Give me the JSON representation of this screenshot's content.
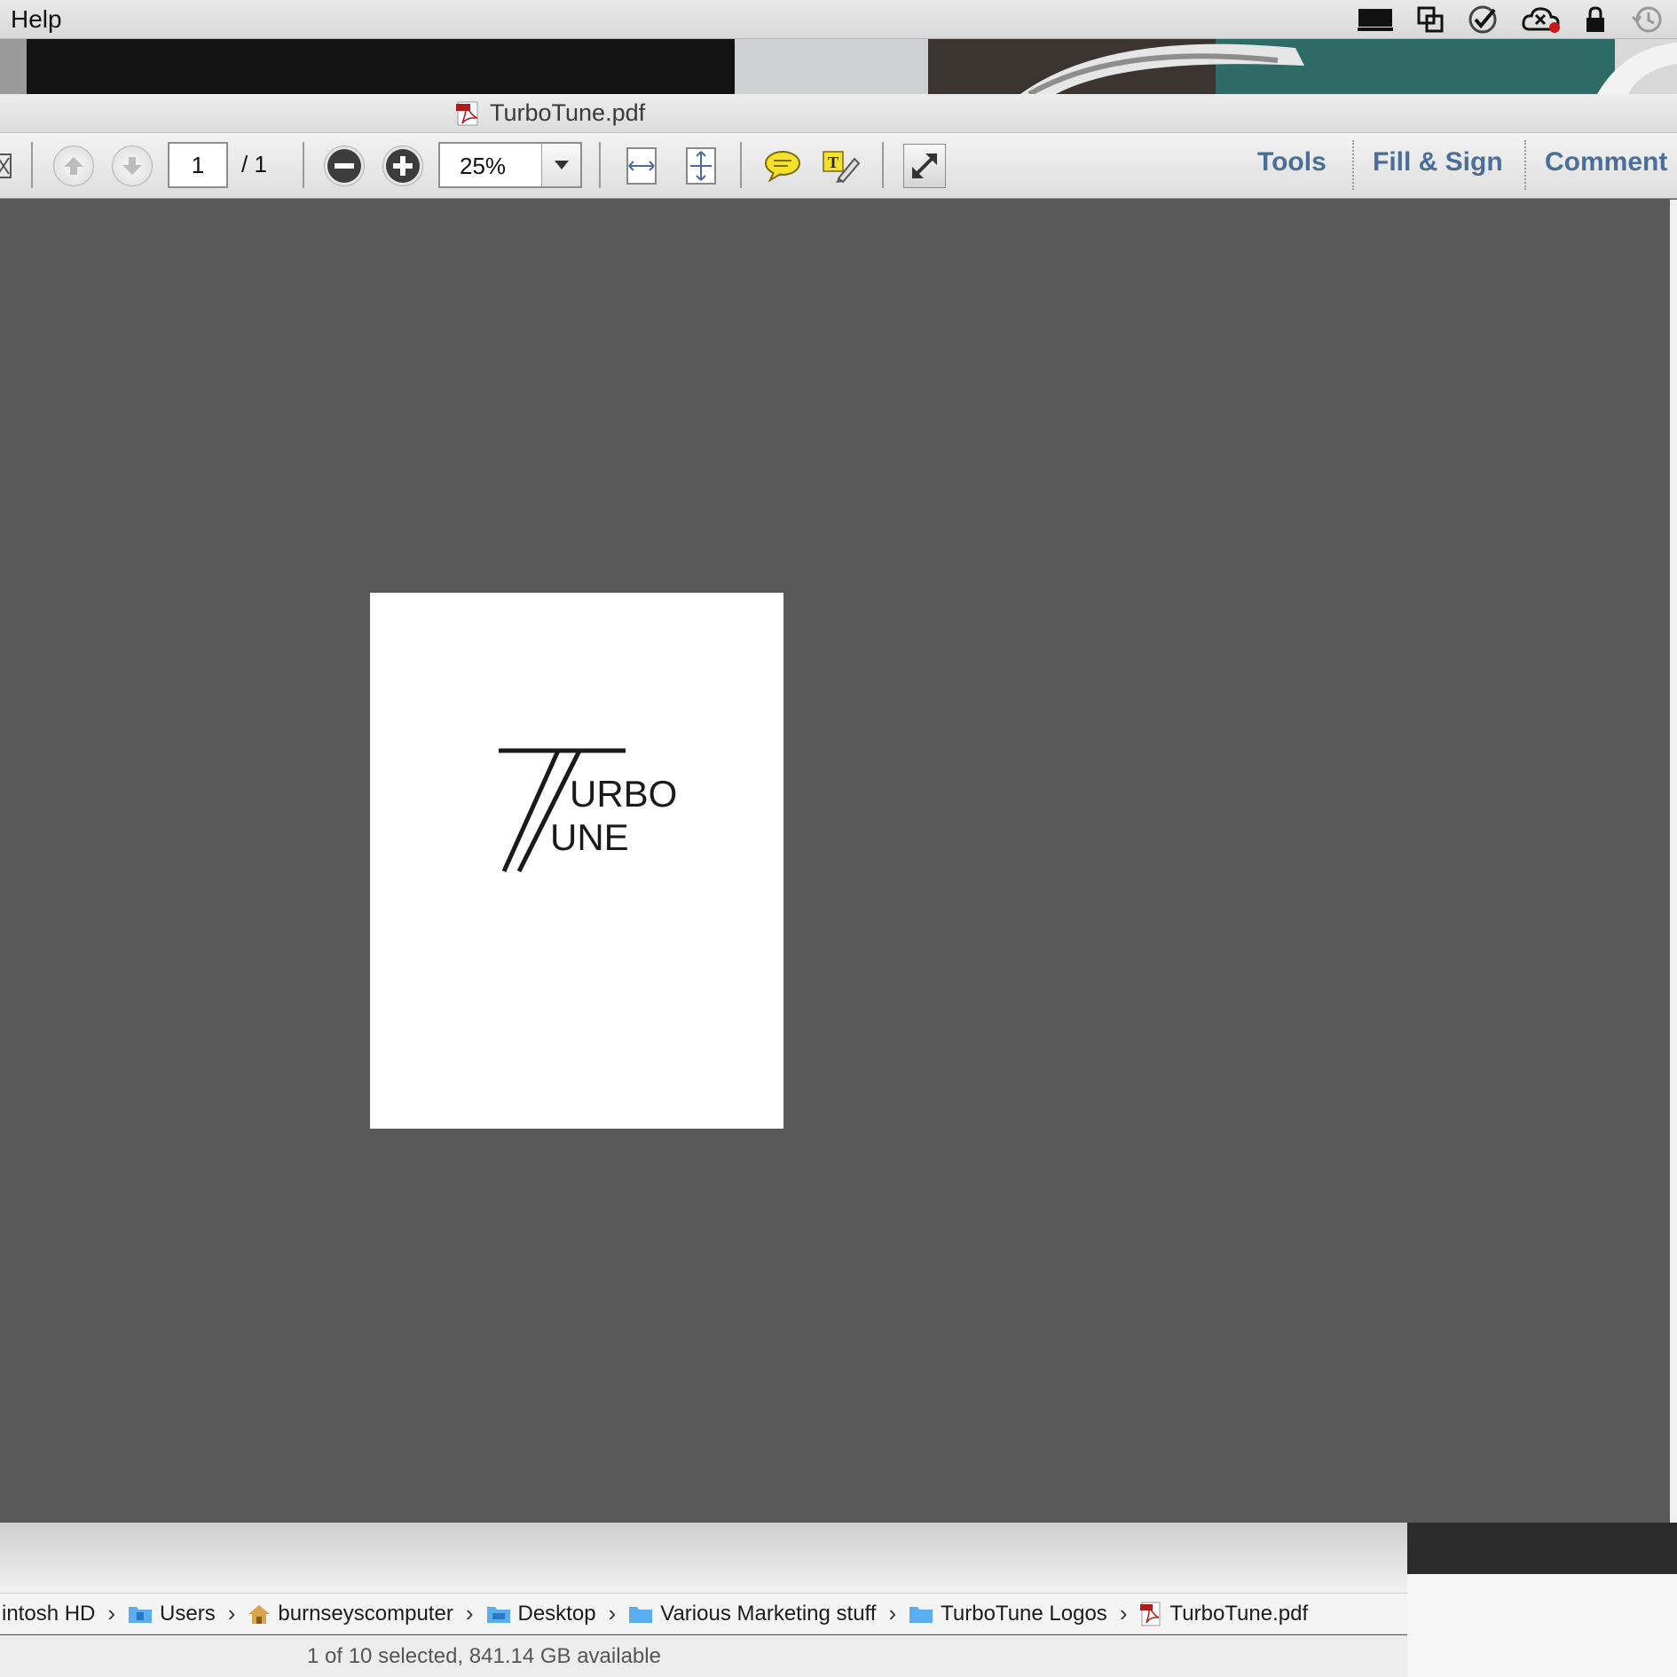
{
  "menubar": {
    "help_label": "Help"
  },
  "tray": {
    "icons": [
      "display-icon",
      "window-switch-icon",
      "check-icon",
      "cloud-error-icon",
      "lock-icon",
      "time-machine-icon"
    ]
  },
  "window": {
    "title": "TurboTune.pdf"
  },
  "toolbar": {
    "page_current": "1",
    "page_total": "/ 1",
    "zoom": "25%",
    "tabs": {
      "tools": "Tools",
      "fill_sign": "Fill & Sign",
      "comment": "Comment"
    }
  },
  "document": {
    "logo_text_line1": "URBO",
    "logo_text_line2": "UNE"
  },
  "finder": {
    "path": [
      "intosh HD",
      "Users",
      "burnseyscomputer",
      "Desktop",
      "Various Marketing stuff",
      "TurboTune Logos",
      "TurboTune.pdf"
    ],
    "status": "1 of 10 selected, 841.14 GB available"
  },
  "colors": {
    "accent_tab": "#4b6e99",
    "doc_background": "#595959"
  }
}
